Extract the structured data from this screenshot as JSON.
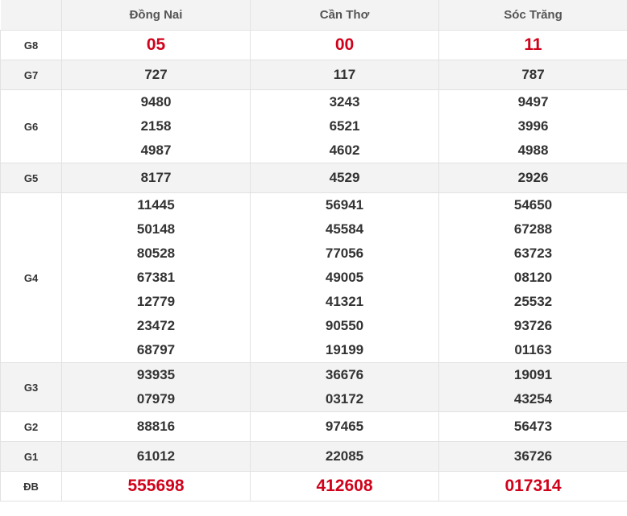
{
  "header": {
    "provinces": [
      "Đồng Nai",
      "Cần Thơ",
      "Sóc Trăng"
    ]
  },
  "colors": {
    "accent_red": "#d0021b",
    "text": "#333333",
    "stripe": "#f3f3f3"
  },
  "rows": [
    {
      "label": "G8",
      "highlight": true,
      "big": true,
      "values": [
        [
          "05"
        ],
        [
          "00"
        ],
        [
          "11"
        ]
      ]
    },
    {
      "label": "G7",
      "values": [
        [
          "727"
        ],
        [
          "117"
        ],
        [
          "787"
        ]
      ]
    },
    {
      "label": "G6",
      "values": [
        [
          "9480",
          "2158",
          "4987"
        ],
        [
          "3243",
          "6521",
          "4602"
        ],
        [
          "9497",
          "3996",
          "4988"
        ]
      ]
    },
    {
      "label": "G5",
      "values": [
        [
          "8177"
        ],
        [
          "4529"
        ],
        [
          "2926"
        ]
      ]
    },
    {
      "label": "G4",
      "values": [
        [
          "11445",
          "50148",
          "80528",
          "67381",
          "12779",
          "23472",
          "68797"
        ],
        [
          "56941",
          "45584",
          "77056",
          "49005",
          "41321",
          "90550",
          "19199"
        ],
        [
          "54650",
          "67288",
          "63723",
          "08120",
          "25532",
          "93726",
          "01163"
        ]
      ]
    },
    {
      "label": "G3",
      "values": [
        [
          "93935",
          "07979"
        ],
        [
          "36676",
          "03172"
        ],
        [
          "19091",
          "43254"
        ]
      ]
    },
    {
      "label": "G2",
      "values": [
        [
          "88816"
        ],
        [
          "97465"
        ],
        [
          "56473"
        ]
      ]
    },
    {
      "label": "G1",
      "values": [
        [
          "61012"
        ],
        [
          "22085"
        ],
        [
          "36726"
        ]
      ]
    },
    {
      "label": "ĐB",
      "highlight": true,
      "big": true,
      "values": [
        [
          "555698"
        ],
        [
          "412608"
        ],
        [
          "017314"
        ]
      ]
    }
  ]
}
